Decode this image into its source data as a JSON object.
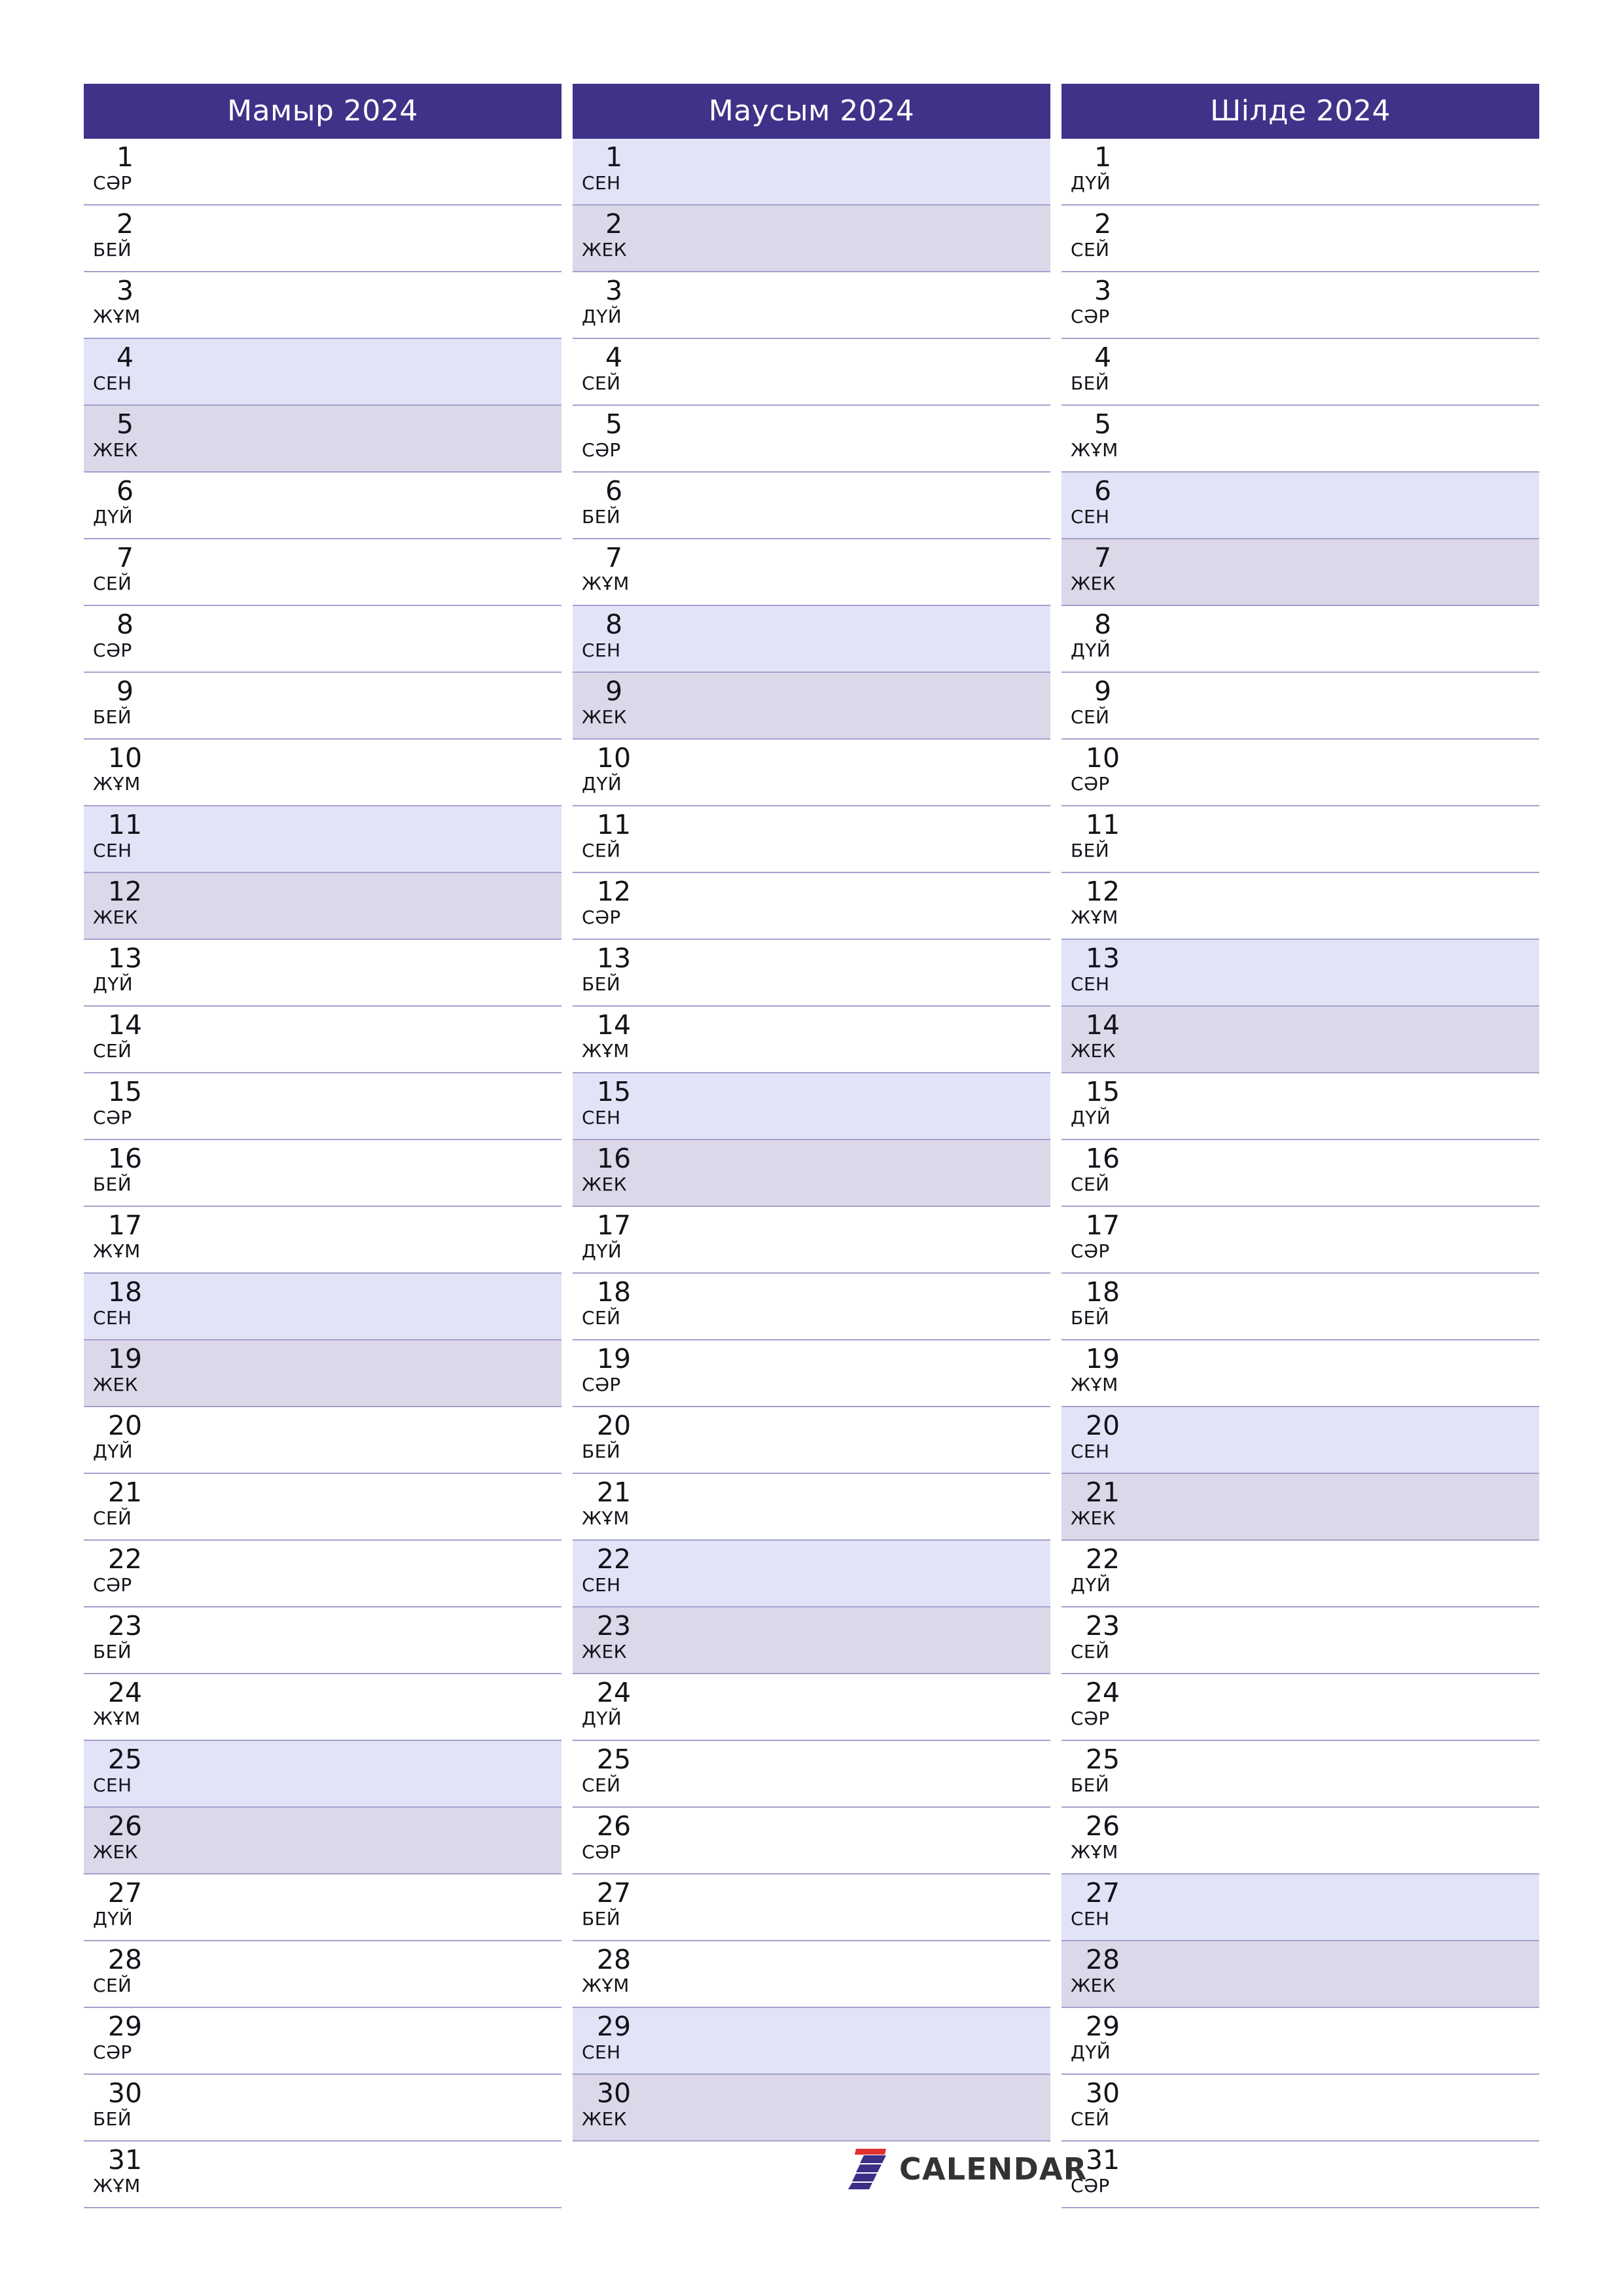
{
  "page": {
    "background_color": "#ffffff",
    "accent_color": "#403189",
    "saturday_color": "#e3e3f7",
    "sunday_color": "#dcd7e9",
    "grid_line_color": "#a3a2ce",
    "text_color": "#13131a"
  },
  "brand": {
    "name": "CALENDAR",
    "mark_icon": "calendar-seven-logo-icon",
    "mark_colors": {
      "stripe": "#3b2f86",
      "accent": "#e03030"
    }
  },
  "months": [
    {
      "title": "Мамыр 2024",
      "days": [
        {
          "num": "1",
          "weekday": "СӘР",
          "type": "weekday"
        },
        {
          "num": "2",
          "weekday": "БЕЙ",
          "type": "weekday"
        },
        {
          "num": "3",
          "weekday": "ЖҰМ",
          "type": "weekday"
        },
        {
          "num": "4",
          "weekday": "СЕН",
          "type": "sat"
        },
        {
          "num": "5",
          "weekday": "ЖЕК",
          "type": "sun"
        },
        {
          "num": "6",
          "weekday": "ДҮЙ",
          "type": "weekday"
        },
        {
          "num": "7",
          "weekday": "СЕЙ",
          "type": "weekday"
        },
        {
          "num": "8",
          "weekday": "СӘР",
          "type": "weekday"
        },
        {
          "num": "9",
          "weekday": "БЕЙ",
          "type": "weekday"
        },
        {
          "num": "10",
          "weekday": "ЖҰМ",
          "type": "weekday"
        },
        {
          "num": "11",
          "weekday": "СЕН",
          "type": "sat"
        },
        {
          "num": "12",
          "weekday": "ЖЕК",
          "type": "sun"
        },
        {
          "num": "13",
          "weekday": "ДҮЙ",
          "type": "weekday"
        },
        {
          "num": "14",
          "weekday": "СЕЙ",
          "type": "weekday"
        },
        {
          "num": "15",
          "weekday": "СӘР",
          "type": "weekday"
        },
        {
          "num": "16",
          "weekday": "БЕЙ",
          "type": "weekday"
        },
        {
          "num": "17",
          "weekday": "ЖҰМ",
          "type": "weekday"
        },
        {
          "num": "18",
          "weekday": "СЕН",
          "type": "sat"
        },
        {
          "num": "19",
          "weekday": "ЖЕК",
          "type": "sun"
        },
        {
          "num": "20",
          "weekday": "ДҮЙ",
          "type": "weekday"
        },
        {
          "num": "21",
          "weekday": "СЕЙ",
          "type": "weekday"
        },
        {
          "num": "22",
          "weekday": "СӘР",
          "type": "weekday"
        },
        {
          "num": "23",
          "weekday": "БЕЙ",
          "type": "weekday"
        },
        {
          "num": "24",
          "weekday": "ЖҰМ",
          "type": "weekday"
        },
        {
          "num": "25",
          "weekday": "СЕН",
          "type": "sat"
        },
        {
          "num": "26",
          "weekday": "ЖЕК",
          "type": "sun"
        },
        {
          "num": "27",
          "weekday": "ДҮЙ",
          "type": "weekday"
        },
        {
          "num": "28",
          "weekday": "СЕЙ",
          "type": "weekday"
        },
        {
          "num": "29",
          "weekday": "СӘР",
          "type": "weekday"
        },
        {
          "num": "30",
          "weekday": "БЕЙ",
          "type": "weekday"
        },
        {
          "num": "31",
          "weekday": "ЖҰМ",
          "type": "weekday"
        }
      ]
    },
    {
      "title": "Маусым 2024",
      "days": [
        {
          "num": "1",
          "weekday": "СЕН",
          "type": "sat"
        },
        {
          "num": "2",
          "weekday": "ЖЕК",
          "type": "sun"
        },
        {
          "num": "3",
          "weekday": "ДҮЙ",
          "type": "weekday"
        },
        {
          "num": "4",
          "weekday": "СЕЙ",
          "type": "weekday"
        },
        {
          "num": "5",
          "weekday": "СӘР",
          "type": "weekday"
        },
        {
          "num": "6",
          "weekday": "БЕЙ",
          "type": "weekday"
        },
        {
          "num": "7",
          "weekday": "ЖҰМ",
          "type": "weekday"
        },
        {
          "num": "8",
          "weekday": "СЕН",
          "type": "sat"
        },
        {
          "num": "9",
          "weekday": "ЖЕК",
          "type": "sun"
        },
        {
          "num": "10",
          "weekday": "ДҮЙ",
          "type": "weekday"
        },
        {
          "num": "11",
          "weekday": "СЕЙ",
          "type": "weekday"
        },
        {
          "num": "12",
          "weekday": "СӘР",
          "type": "weekday"
        },
        {
          "num": "13",
          "weekday": "БЕЙ",
          "type": "weekday"
        },
        {
          "num": "14",
          "weekday": "ЖҰМ",
          "type": "weekday"
        },
        {
          "num": "15",
          "weekday": "СЕН",
          "type": "sat"
        },
        {
          "num": "16",
          "weekday": "ЖЕК",
          "type": "sun"
        },
        {
          "num": "17",
          "weekday": "ДҮЙ",
          "type": "weekday"
        },
        {
          "num": "18",
          "weekday": "СЕЙ",
          "type": "weekday"
        },
        {
          "num": "19",
          "weekday": "СӘР",
          "type": "weekday"
        },
        {
          "num": "20",
          "weekday": "БЕЙ",
          "type": "weekday"
        },
        {
          "num": "21",
          "weekday": "ЖҰМ",
          "type": "weekday"
        },
        {
          "num": "22",
          "weekday": "СЕН",
          "type": "sat"
        },
        {
          "num": "23",
          "weekday": "ЖЕК",
          "type": "sun"
        },
        {
          "num": "24",
          "weekday": "ДҮЙ",
          "type": "weekday"
        },
        {
          "num": "25",
          "weekday": "СЕЙ",
          "type": "weekday"
        },
        {
          "num": "26",
          "weekday": "СӘР",
          "type": "weekday"
        },
        {
          "num": "27",
          "weekday": "БЕЙ",
          "type": "weekday"
        },
        {
          "num": "28",
          "weekday": "ЖҰМ",
          "type": "weekday"
        },
        {
          "num": "29",
          "weekday": "СЕН",
          "type": "sat"
        },
        {
          "num": "30",
          "weekday": "ЖЕК",
          "type": "sun"
        }
      ]
    },
    {
      "title": "Шілде 2024",
      "days": [
        {
          "num": "1",
          "weekday": "ДҮЙ",
          "type": "weekday"
        },
        {
          "num": "2",
          "weekday": "СЕЙ",
          "type": "weekday"
        },
        {
          "num": "3",
          "weekday": "СӘР",
          "type": "weekday"
        },
        {
          "num": "4",
          "weekday": "БЕЙ",
          "type": "weekday"
        },
        {
          "num": "5",
          "weekday": "ЖҰМ",
          "type": "weekday"
        },
        {
          "num": "6",
          "weekday": "СЕН",
          "type": "sat"
        },
        {
          "num": "7",
          "weekday": "ЖЕК",
          "type": "sun"
        },
        {
          "num": "8",
          "weekday": "ДҮЙ",
          "type": "weekday"
        },
        {
          "num": "9",
          "weekday": "СЕЙ",
          "type": "weekday"
        },
        {
          "num": "10",
          "weekday": "СӘР",
          "type": "weekday"
        },
        {
          "num": "11",
          "weekday": "БЕЙ",
          "type": "weekday"
        },
        {
          "num": "12",
          "weekday": "ЖҰМ",
          "type": "weekday"
        },
        {
          "num": "13",
          "weekday": "СЕН",
          "type": "sat"
        },
        {
          "num": "14",
          "weekday": "ЖЕК",
          "type": "sun"
        },
        {
          "num": "15",
          "weekday": "ДҮЙ",
          "type": "weekday"
        },
        {
          "num": "16",
          "weekday": "СЕЙ",
          "type": "weekday"
        },
        {
          "num": "17",
          "weekday": "СӘР",
          "type": "weekday"
        },
        {
          "num": "18",
          "weekday": "БЕЙ",
          "type": "weekday"
        },
        {
          "num": "19",
          "weekday": "ЖҰМ",
          "type": "weekday"
        },
        {
          "num": "20",
          "weekday": "СЕН",
          "type": "sat"
        },
        {
          "num": "21",
          "weekday": "ЖЕК",
          "type": "sun"
        },
        {
          "num": "22",
          "weekday": "ДҮЙ",
          "type": "weekday"
        },
        {
          "num": "23",
          "weekday": "СЕЙ",
          "type": "weekday"
        },
        {
          "num": "24",
          "weekday": "СӘР",
          "type": "weekday"
        },
        {
          "num": "25",
          "weekday": "БЕЙ",
          "type": "weekday"
        },
        {
          "num": "26",
          "weekday": "ЖҰМ",
          "type": "weekday"
        },
        {
          "num": "27",
          "weekday": "СЕН",
          "type": "sat"
        },
        {
          "num": "28",
          "weekday": "ЖЕК",
          "type": "sun"
        },
        {
          "num": "29",
          "weekday": "ДҮЙ",
          "type": "weekday"
        },
        {
          "num": "30",
          "weekday": "СЕЙ",
          "type": "weekday"
        },
        {
          "num": "31",
          "weekday": "СӘР",
          "type": "weekday"
        }
      ]
    }
  ]
}
